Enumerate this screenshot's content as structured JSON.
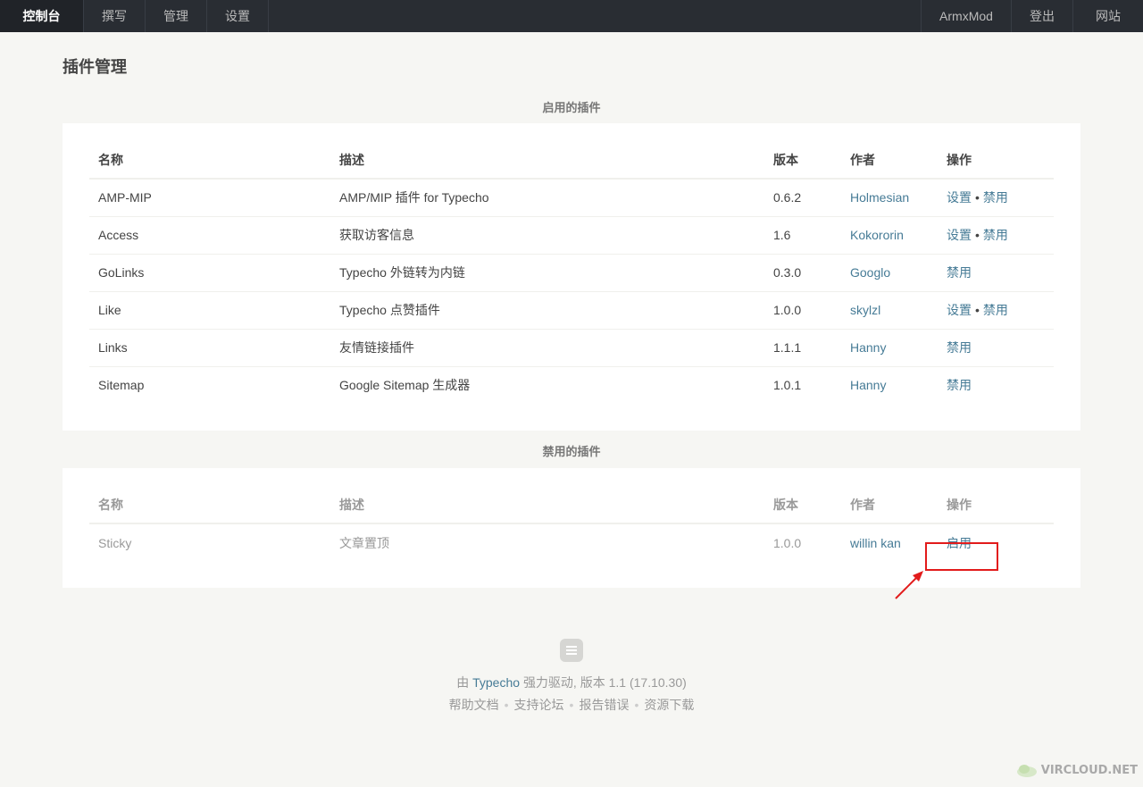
{
  "nav": {
    "left": [
      {
        "label": "控制台",
        "active": true
      },
      {
        "label": "撰写"
      },
      {
        "label": "管理"
      },
      {
        "label": "设置"
      }
    ],
    "right": [
      {
        "label": "ArmxMod"
      },
      {
        "label": "登出"
      },
      {
        "label": "网站"
      }
    ]
  },
  "page": {
    "title": "插件管理"
  },
  "active_section": {
    "caption": "启用的插件",
    "headers": [
      "名称",
      "描述",
      "版本",
      "作者",
      "操作"
    ],
    "rows": [
      {
        "name": "AMP-MIP",
        "desc": "AMP/MIP 插件 for Typecho",
        "version": "0.6.2",
        "author": "Holmesian",
        "settings": "设置",
        "action": "禁用"
      },
      {
        "name": "Access",
        "desc": "获取访客信息",
        "version": "1.6",
        "author": "Kokororin",
        "settings": "设置",
        "action": "禁用"
      },
      {
        "name": "GoLinks",
        "desc": "Typecho 外链转为内链",
        "version": "0.3.0",
        "author": "Googlo",
        "settings": "",
        "action": "禁用"
      },
      {
        "name": "Like",
        "desc": "Typecho 点赞插件",
        "version": "1.0.0",
        "author": "skylzl",
        "settings": "设置",
        "action": "禁用"
      },
      {
        "name": "Links",
        "desc": "友情链接插件",
        "version": "1.1.1",
        "author": "Hanny",
        "settings": "",
        "action": "禁用"
      },
      {
        "name": "Sitemap",
        "desc": "Google Sitemap 生成器",
        "version": "1.0.1",
        "author": "Hanny",
        "settings": "",
        "action": "禁用"
      }
    ]
  },
  "disabled_section": {
    "caption": "禁用的插件",
    "headers": [
      "名称",
      "描述",
      "版本",
      "作者",
      "操作"
    ],
    "rows": [
      {
        "name": "Sticky",
        "desc": "文章置顶",
        "version": "1.0.0",
        "author": "willin kan",
        "action": "启用"
      }
    ]
  },
  "footer": {
    "powered_prefix": "由",
    "powered_link": "Typecho",
    "powered_suffix": "强力驱动, 版本 1.1 (17.10.30)",
    "links": [
      "帮助文档",
      "支持论坛",
      "报告错误",
      "资源下载"
    ]
  },
  "watermark": "VIRCLOUD.NET",
  "colors": {
    "topbar": "#292d33",
    "link": "#467b96",
    "background": "#f6f6f3",
    "highlight": "#e21b1b"
  }
}
